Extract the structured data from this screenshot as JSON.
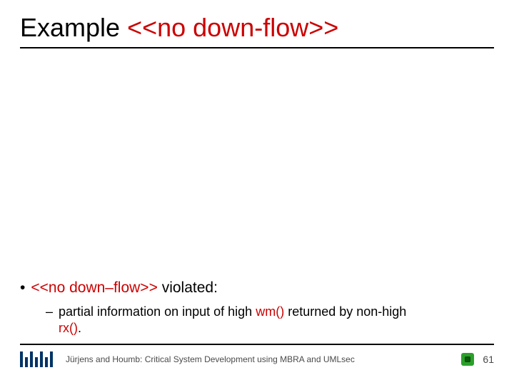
{
  "title": {
    "black": "Example",
    "red": "<<no down-flow>>"
  },
  "bullet": {
    "pre": "<<no down–flow>>",
    "post": "violated:"
  },
  "sub": {
    "t1": "partial information on input of high",
    "r1": "wm()",
    "t2": "returned by non-high",
    "r2": "rx()",
    "t3": "."
  },
  "footer": {
    "text": "Jürjens and Houmb: Critical System Development using MBRA and UMLsec",
    "page": "61"
  }
}
